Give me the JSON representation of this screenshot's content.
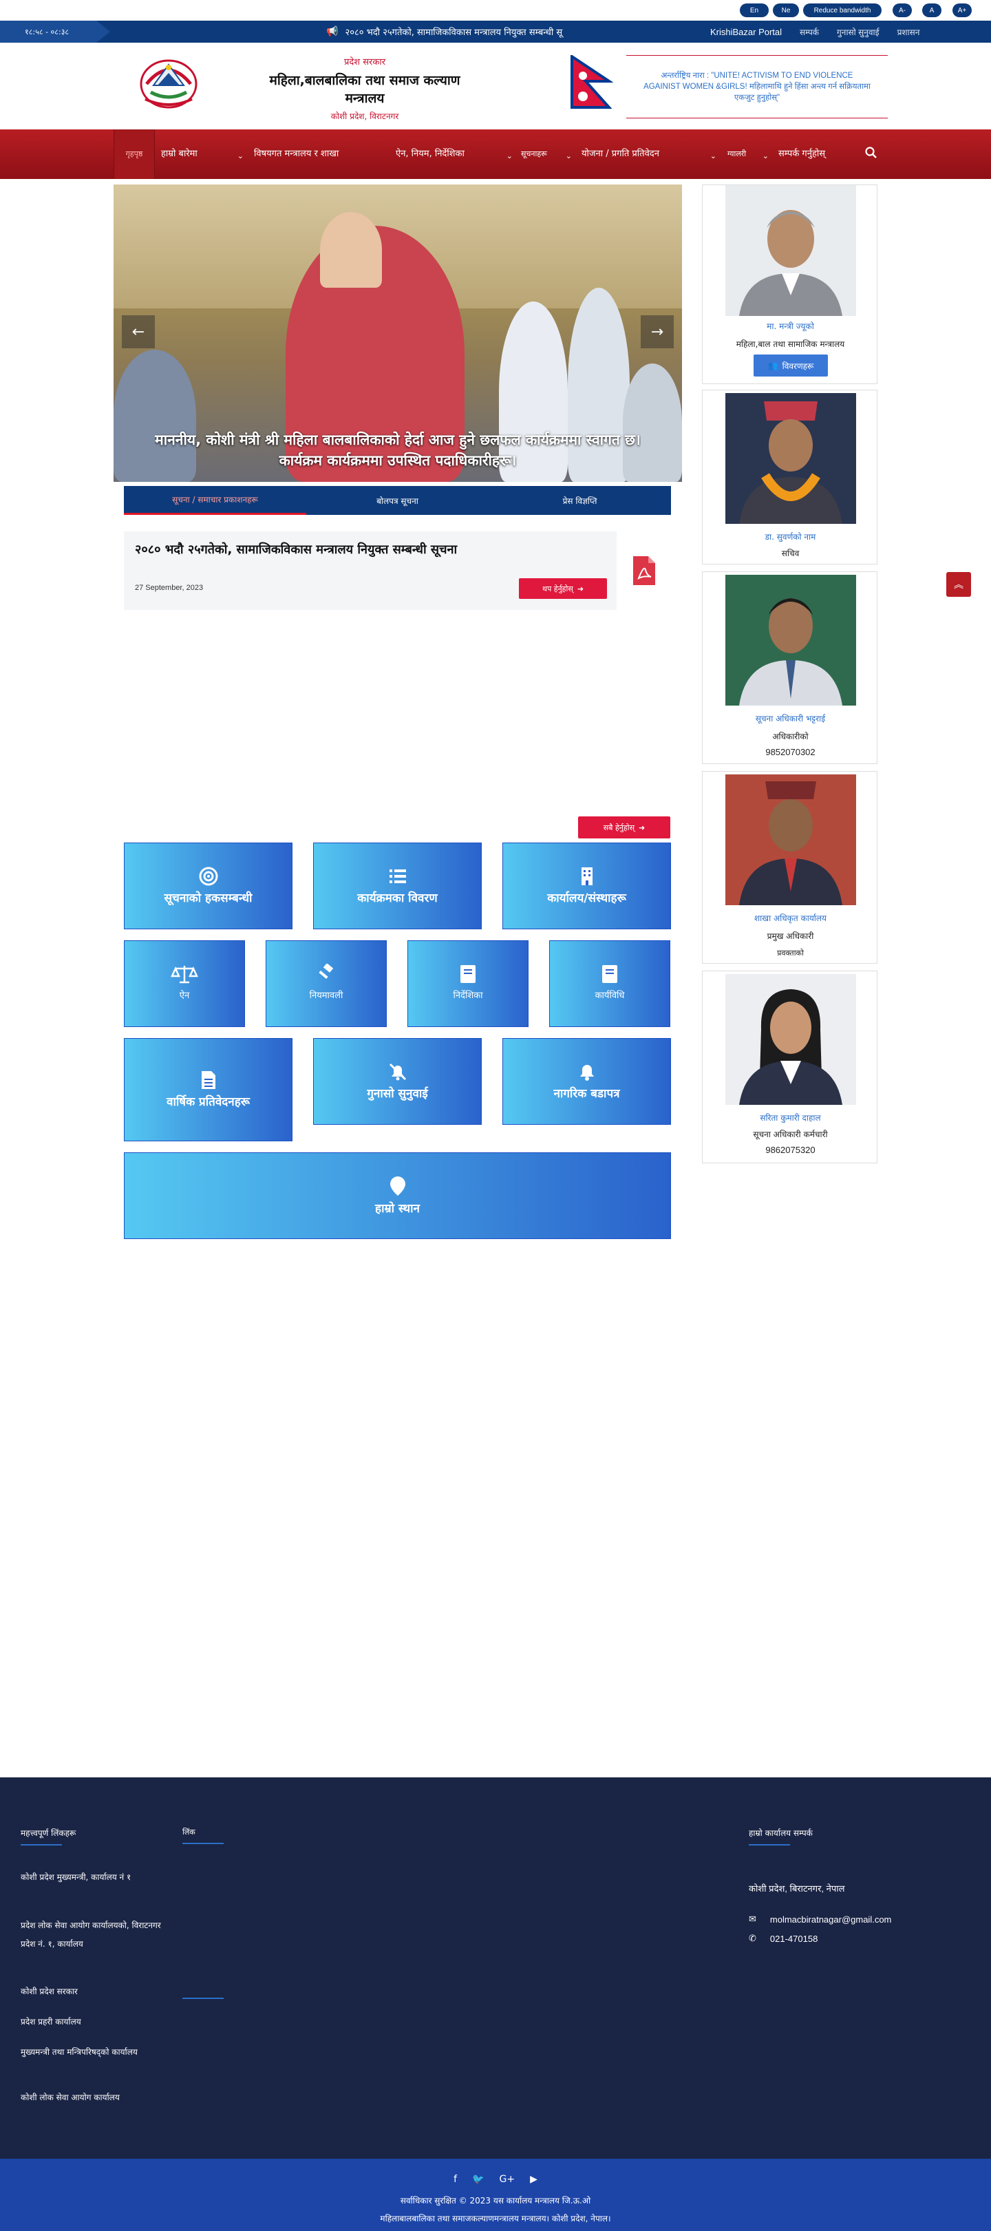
{
  "topbar": {
    "lang_en": "En",
    "lang_ne": "Ne",
    "reduce_bandwidth": "Reduce bandwidth",
    "font_minus": "A-",
    "font_normal": "A",
    "font_plus": "A+"
  },
  "ticker": {
    "date": "१८:५८ - ०८:३८",
    "headline": "२०८० भदौ २५गतेको, सामाजिकविकास मन्त्रालय नियुक्त सम्बन्धी सू",
    "links": [
      "KrishiBazar Portal",
      "सम्पर्क",
      "गुनासो सुनुवाई",
      "प्रशासन"
    ]
  },
  "header": {
    "ministry_small": "प्रदेश सरकार",
    "office_title": "महिला,बालबालिका तथा समाज कल्याण मन्त्रालय",
    "location": "कोशी प्रदेश, विराटनगर",
    "slogan": "अन्तर्राष्ट्रिय नारा : \"UNITE! ACTIVISM TO END VIOLENCE AGAINIST WOMEN &GIRLS! महिलामाथि हुने हिंसा अन्त्य गर्न सक्रियतामा एकजुट हुनुहोस्\""
  },
  "nav": {
    "items": [
      {
        "label": "गृहपृष्ठ",
        "active": true
      },
      {
        "label": "हाम्रो बारेमा",
        "dropdown": true
      },
      {
        "label": "विषयगत मन्त्रालय र शाखा",
        "dropdown": false
      },
      {
        "label": "ऐन, नियम, निर्देशिका",
        "dropdown": true
      },
      {
        "label": "सूचनाहरू",
        "dropdown": true
      },
      {
        "label": "योजना / प्रगति प्रतिवेदन",
        "dropdown": true
      },
      {
        "label": "ग्यालरी",
        "dropdown": true
      },
      {
        "label": "सम्पर्क गर्नुहोस्",
        "dropdown": false
      }
    ]
  },
  "hero": {
    "caption": "माननीय, कोशी मंत्री श्री महिला बालबालिकाको हेर्दा आज हुने छलफल कार्यक्रममा स्वागत छ। कार्यक्रम कार्यक्रममा उपस्थित पदाधिकारीहरू।"
  },
  "tabs": [
    "सूचना / समाचार प्रकाशनहरू",
    "बोलपत्र सूचना",
    "प्रेस विज्ञप्ति"
  ],
  "notice": {
    "title": "२०८० भदौ २५गतेको, सामाजिकविकास मन्त्रालय नियुक्त सम्बन्धी सूचना",
    "date": "27 September, 2023",
    "view_button": "थप हेर्नुहोस्"
  },
  "services": {
    "all_button": "सबै हेर्नुहोस्",
    "row1": [
      "सूचनाको हकसम्बन्धी",
      "कार्यक्रमका विवरण",
      "कार्यालय/संस्थाहरू"
    ],
    "row2": [
      "ऐन",
      "नियमावली",
      "निर्देशिका",
      "कार्यविधि"
    ],
    "row3": [
      "वार्षिक प्रतिवेदनहरू",
      "गुनासो सुनुवाई",
      "नागरिक बडापत्र"
    ],
    "row4": "हाम्रो स्थान"
  },
  "officials": [
    {
      "name": "मा. मन्त्री ज्यूको",
      "role": "महिला,बाल तथा सामाजिक मन्त्रालय",
      "button": "विवरणहरू"
    },
    {
      "name": "डा. सुवर्णको नाम",
      "role": "सचिव"
    },
    {
      "name": "सूचना अधिकारी भट्टराई",
      "role": "अधिकारीको",
      "phone": "9852070302"
    },
    {
      "name": "शाखा अधिकृत कार्यालय",
      "role": "प्रमुख अधिकारी",
      "phone": "प्रवक्ताको"
    },
    {
      "name": "सरिता कुमारी दाहाल",
      "role": "सूचना अधिकारी कर्मचारी",
      "phone": "9862075320"
    }
  ],
  "footer": {
    "col1_title": "महत्त्वपूर्ण लिंकहरू",
    "col1_links": [
      "कोशी प्रदेश मुख्यमन्त्री, कार्यालय नं १",
      "प्रदेश लोक सेवा आयोग कार्यालयको, विराटनगर प्रदेश नं. १, कार्यालय",
      "कोशी प्रदेश सरकार",
      "प्रदेश प्रहरी कार्यालय",
      "मुख्यमन्त्री तथा मन्त्रिपरिषद्को कार्यालय",
      "कोशी लोक सेवा आयोग कार्यालय"
    ],
    "col2_title": "लिंक",
    "col3_title": "हाम्रो कार्यालय सम्पर्क",
    "address": "कोशी प्रदेश, बिराटनगर, नेपाल",
    "email": "molmacbiratnagar@gmail.com",
    "phone": "021-470158",
    "copyright": "सर्वाधिकार सुरक्षित © 2023 यस कार्यालय मन्त्रालय जि.ऊ.ओ",
    "credit": "महिलाबालबालिका तथा समाजकल्याणमन्त्रालय मन्त्रालय। कोशी प्रदेश, नेपाल।"
  },
  "colors": {
    "brand_blue": "#0d3a7a",
    "brand_red": "#b81e23",
    "accent_pink": "#e0183d",
    "footer_bg": "#1a2444",
    "bottom_bar": "#1d45a8"
  }
}
